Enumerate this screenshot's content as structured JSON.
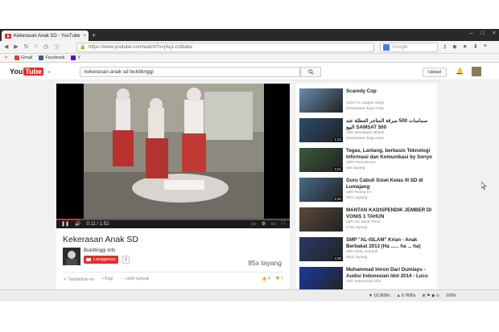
{
  "browser": {
    "tab_title": "Kekerasan Anak SD - YouTube",
    "tab_close": "×",
    "new_tab": "+",
    "url": "https://www.youtube.com/watch?v=jXq1-m3batw",
    "search_engine_placeholder": "Google",
    "window_controls": [
      "–",
      "□",
      "×"
    ]
  },
  "bookmarks": [
    {
      "label": "Gmail",
      "color": "#d44638"
    },
    {
      "label": "Facebook",
      "color": "#3b5998"
    },
    {
      "label": "Y",
      "color": "#5f01d1"
    }
  ],
  "youtube": {
    "logo_you": "You",
    "logo_tube": "Tube",
    "search_query": "kekerasan anak sd bukittinggi",
    "upload_label": "Upload",
    "accent": "#e52d27"
  },
  "player": {
    "time": "0:11 / 1:52",
    "progress": 0.1
  },
  "video": {
    "title": "Kekerasan Anak SD",
    "channel": "Bukittinggi Info",
    "subscribe_label": "Langganan",
    "subscriber_count": "2",
    "views": "85x tayang",
    "actions": [
      "Tambahkan ke",
      "Bagi",
      "Lebih banyak"
    ],
    "likes": "4",
    "dislikes": "7"
  },
  "recommendations": [
    {
      "title": "Scaredy Cop",
      "channel": "Just For Laughs Gags",
      "views": "Disarankan bagi Anda",
      "duration": "",
      "thumb": "#6b8cae"
    },
    {
      "title": "سماسات 500 سرقة المتاجر العطلة عند البيع SAMSAT 500",
      "channel": "oleh alzoubaidi albasli",
      "views": "Disarankan bagi Anda",
      "duration": "1:22",
      "thumb": "#2c4d6b"
    },
    {
      "title": "Tegas, Lantang, berbasis Teknologi Informasi dan Komunikasi by Sonyo",
      "channel": "oleh Petra Bicara",
      "views": "54x tayang",
      "duration": "4:21",
      "thumb": "#3a5a3a"
    },
    {
      "title": "Guru Cabuli Siswi Kelas III SD di Lumajang",
      "channel": "oleh Ruang Ini",
      "views": "367x tayang",
      "duration": "2:20",
      "thumb": "#4a6a8a"
    },
    {
      "title": "MANTAN KADISPENDIK JEMBER DI VONIS 1 TAHUN",
      "channel": "oleh Isu Jawa Timur",
      "views": "179x tayang",
      "duration": "",
      "thumb": "#5a4a3a"
    },
    {
      "title": "SMP \"AL-ISLAM\" Krian - Anak Berbakat 2013 (Ha ...... ha ... ha)",
      "channel": "oleh Dedy Suhardi",
      "views": "953x tayang",
      "duration": "3:39",
      "thumb": "#2a3a6a"
    },
    {
      "title": "Muhammad Imron Dari Dumlayu - Audisi Indonesian Idol 2014 - Lucu",
      "channel": "oleh Indonesian Idol",
      "views": "",
      "duration": "",
      "thumb": "#1a3aa0"
    }
  ],
  "status": {
    "down_speed": "19.2KB/s",
    "up_speed": "6.7KB/s",
    "zoom": "100%"
  }
}
